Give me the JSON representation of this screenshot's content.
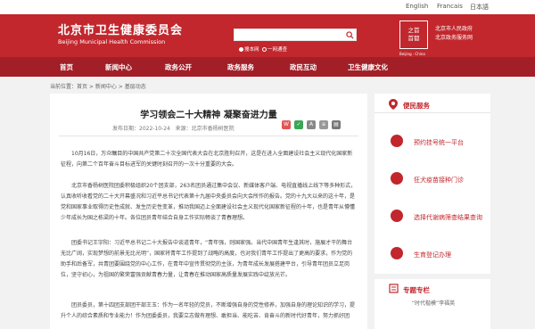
{
  "langs": [
    "English",
    "Francais",
    "日本語"
  ],
  "header": {
    "site_name_cn": "北京市卫生健康委员会",
    "site_name_en": "Beijing Municipal Health Commission",
    "search_scope": [
      "搜本网",
      "一网通查"
    ],
    "emblem_text": [
      "之首",
      "首都"
    ],
    "emblem_sub": "Beijing · China",
    "links": [
      "北京市人民政府",
      "北京政务服务网"
    ]
  },
  "nav": [
    "首页",
    "新闻中心",
    "政务公开",
    "政务服务",
    "政民互动",
    "卫生健康文化"
  ],
  "breadcrumb": {
    "label": "当前位置：",
    "path": "首页 > 新闻中心 > 基层动态"
  },
  "article": {
    "title": "学习领会二十大精神 凝聚奋进力量",
    "date": "发布日期：2022-10-24",
    "source": "来源：北京市香杨树医院",
    "paragraphs": [
      "10月16日，万众瞩目的中国共产党第二十次全国代表大会在北京胜利召开，这是在进入全面建设社会主义现代化国家新征程，向第二个百年奋斗目标进军的关键时刻召开的一次十分重要的大会。",
      "北京市香杨树医院团委积极组织20个团支部，263名团员通过集中会议、新媒体客户端、电视直播线上线下等多种形式，认真收听收看党的二十大开幕盛况和习近平总书记代表第十九届中央委员会向大会所作的报告。党的十九大以来的这十年，是党和国家事业取得历史性成就、发生历史性变革，推动我国迈上全面建设社会主义现代化国家新征程的十年，也是青年从懵懂少年成长为国之栋梁的十年。各位团员青年结合自身工作实际畅谈了青春理想。",
      "团委书记王宇阳：习近平总书记二十大报告中谈道青年，“青年强，则国家强。当代中国青年生逢其时，施展才干的舞台无比广阔，实现梦想的前景无比光明”，国家将青年工作提到了战略的高度，也对我们青年工作提出了更高的要求，作为党的助手和后备军，共青团要围绕党的中心工作，在青年中宣传贯彻党的主张，为青年成长发展搭建平台，引导青年团员立足岗位，坚守初心，为祖国的繁荣富强贡献青春力量，让青春在推动国家高质量发展实践中绽放光芒。",
      "团员委员，第十四团支部团干部王玉：作为一名年轻的党员，不断增强自身的党性修养，加强自身的理论知识的学习，提升个人的综合素质和专业能力！作为团委委员，我要立志做有理想、敢担当、能吃苦、肯奋斗的新时代好青年，努力抓好团"
    ]
  },
  "sidebar": {
    "title": "便民服务",
    "items": [
      "预约挂号统一平台",
      "狂犬疫苗接种门诊",
      "选择代谢病筛查结果查询",
      "生育登记办理"
    ]
  },
  "special": {
    "title": "专题专栏",
    "card": "“时代楷模”李福英"
  },
  "colors": {
    "brand": "#c1272d",
    "nav": "#a21f27"
  }
}
